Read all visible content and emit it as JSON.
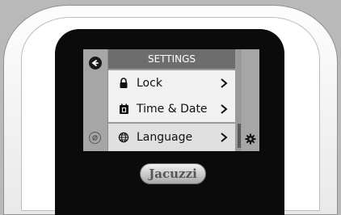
{
  "device": {
    "brand_logo": "Jacuzzi"
  },
  "screen": {
    "title": "SETTINGS",
    "back_icon": "back-arrow-icon",
    "menu_items": [
      {
        "label": "Lock",
        "icon": "lock-icon",
        "selected": false
      },
      {
        "label": "Time & Date",
        "icon": "calendar-icon",
        "selected": false
      },
      {
        "label": "Language",
        "icon": "globe-icon",
        "selected": true
      }
    ],
    "left_bottom_icon": "lighting-icon",
    "right_bottom_icon": "gear-icon"
  },
  "colors": {
    "header_bg": "#6d6d6d",
    "row_bg": "#f1f1f1",
    "selected_row_bg": "#e0e0e0"
  }
}
